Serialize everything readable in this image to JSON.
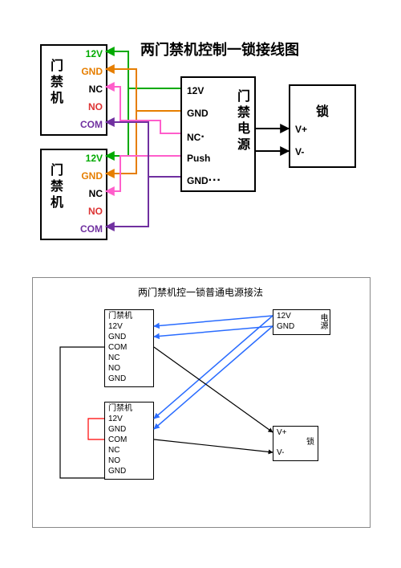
{
  "diagram1": {
    "title": "两门禁机控制一锁接线图",
    "devices": {
      "accessA": {
        "label": "门禁机",
        "pins": [
          "12V",
          "GND",
          "NC",
          "NO",
          "COM"
        ]
      },
      "accessB": {
        "label": "门禁机",
        "pins": [
          "12V",
          "GND",
          "NC",
          "NO",
          "COM"
        ]
      },
      "controller": {
        "label": "门禁电源",
        "pins": [
          "12V",
          "GND",
          "NC",
          "Push",
          "GND"
        ]
      },
      "lock": {
        "label": "锁",
        "pins": [
          "V+",
          "V-"
        ]
      }
    },
    "wire_colors": {
      "12V": "green",
      "GND": "orange",
      "NC": "pink",
      "Push": "pink",
      "COM": "purple",
      "Lock": "black"
    }
  },
  "diagram2": {
    "title": "两门禁机控一锁普通电源接法",
    "devices": {
      "accessA": {
        "label": "门禁机",
        "pins": [
          "12V",
          "GND",
          "COM",
          "NC",
          "NO",
          "GND"
        ]
      },
      "accessB": {
        "label": "门禁机",
        "pins": [
          "12V",
          "GND",
          "COM",
          "NC",
          "NO",
          "GND"
        ]
      },
      "power": {
        "label": "电源",
        "pins": [
          "12V",
          "GND"
        ]
      },
      "lock": {
        "label": "锁",
        "pins": [
          "V+",
          "V-"
        ]
      }
    }
  }
}
